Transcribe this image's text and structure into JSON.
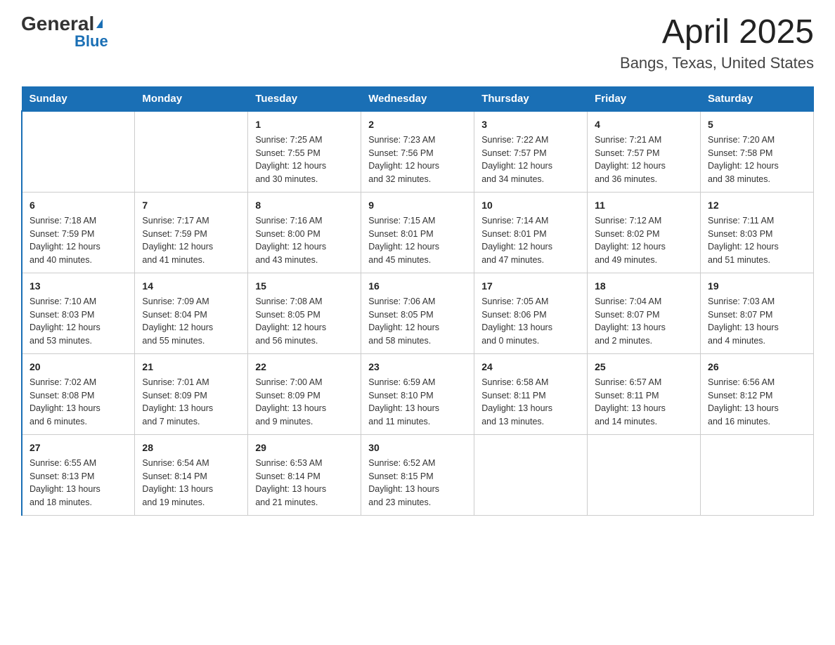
{
  "header": {
    "logo_general": "General",
    "logo_blue": "Blue",
    "title": "April 2025",
    "subtitle": "Bangs, Texas, United States"
  },
  "days_of_week": [
    "Sunday",
    "Monday",
    "Tuesday",
    "Wednesday",
    "Thursday",
    "Friday",
    "Saturday"
  ],
  "weeks": [
    [
      {
        "day": "",
        "detail": ""
      },
      {
        "day": "",
        "detail": ""
      },
      {
        "day": "1",
        "detail": "Sunrise: 7:25 AM\nSunset: 7:55 PM\nDaylight: 12 hours\nand 30 minutes."
      },
      {
        "day": "2",
        "detail": "Sunrise: 7:23 AM\nSunset: 7:56 PM\nDaylight: 12 hours\nand 32 minutes."
      },
      {
        "day": "3",
        "detail": "Sunrise: 7:22 AM\nSunset: 7:57 PM\nDaylight: 12 hours\nand 34 minutes."
      },
      {
        "day": "4",
        "detail": "Sunrise: 7:21 AM\nSunset: 7:57 PM\nDaylight: 12 hours\nand 36 minutes."
      },
      {
        "day": "5",
        "detail": "Sunrise: 7:20 AM\nSunset: 7:58 PM\nDaylight: 12 hours\nand 38 minutes."
      }
    ],
    [
      {
        "day": "6",
        "detail": "Sunrise: 7:18 AM\nSunset: 7:59 PM\nDaylight: 12 hours\nand 40 minutes."
      },
      {
        "day": "7",
        "detail": "Sunrise: 7:17 AM\nSunset: 7:59 PM\nDaylight: 12 hours\nand 41 minutes."
      },
      {
        "day": "8",
        "detail": "Sunrise: 7:16 AM\nSunset: 8:00 PM\nDaylight: 12 hours\nand 43 minutes."
      },
      {
        "day": "9",
        "detail": "Sunrise: 7:15 AM\nSunset: 8:01 PM\nDaylight: 12 hours\nand 45 minutes."
      },
      {
        "day": "10",
        "detail": "Sunrise: 7:14 AM\nSunset: 8:01 PM\nDaylight: 12 hours\nand 47 minutes."
      },
      {
        "day": "11",
        "detail": "Sunrise: 7:12 AM\nSunset: 8:02 PM\nDaylight: 12 hours\nand 49 minutes."
      },
      {
        "day": "12",
        "detail": "Sunrise: 7:11 AM\nSunset: 8:03 PM\nDaylight: 12 hours\nand 51 minutes."
      }
    ],
    [
      {
        "day": "13",
        "detail": "Sunrise: 7:10 AM\nSunset: 8:03 PM\nDaylight: 12 hours\nand 53 minutes."
      },
      {
        "day": "14",
        "detail": "Sunrise: 7:09 AM\nSunset: 8:04 PM\nDaylight: 12 hours\nand 55 minutes."
      },
      {
        "day": "15",
        "detail": "Sunrise: 7:08 AM\nSunset: 8:05 PM\nDaylight: 12 hours\nand 56 minutes."
      },
      {
        "day": "16",
        "detail": "Sunrise: 7:06 AM\nSunset: 8:05 PM\nDaylight: 12 hours\nand 58 minutes."
      },
      {
        "day": "17",
        "detail": "Sunrise: 7:05 AM\nSunset: 8:06 PM\nDaylight: 13 hours\nand 0 minutes."
      },
      {
        "day": "18",
        "detail": "Sunrise: 7:04 AM\nSunset: 8:07 PM\nDaylight: 13 hours\nand 2 minutes."
      },
      {
        "day": "19",
        "detail": "Sunrise: 7:03 AM\nSunset: 8:07 PM\nDaylight: 13 hours\nand 4 minutes."
      }
    ],
    [
      {
        "day": "20",
        "detail": "Sunrise: 7:02 AM\nSunset: 8:08 PM\nDaylight: 13 hours\nand 6 minutes."
      },
      {
        "day": "21",
        "detail": "Sunrise: 7:01 AM\nSunset: 8:09 PM\nDaylight: 13 hours\nand 7 minutes."
      },
      {
        "day": "22",
        "detail": "Sunrise: 7:00 AM\nSunset: 8:09 PM\nDaylight: 13 hours\nand 9 minutes."
      },
      {
        "day": "23",
        "detail": "Sunrise: 6:59 AM\nSunset: 8:10 PM\nDaylight: 13 hours\nand 11 minutes."
      },
      {
        "day": "24",
        "detail": "Sunrise: 6:58 AM\nSunset: 8:11 PM\nDaylight: 13 hours\nand 13 minutes."
      },
      {
        "day": "25",
        "detail": "Sunrise: 6:57 AM\nSunset: 8:11 PM\nDaylight: 13 hours\nand 14 minutes."
      },
      {
        "day": "26",
        "detail": "Sunrise: 6:56 AM\nSunset: 8:12 PM\nDaylight: 13 hours\nand 16 minutes."
      }
    ],
    [
      {
        "day": "27",
        "detail": "Sunrise: 6:55 AM\nSunset: 8:13 PM\nDaylight: 13 hours\nand 18 minutes."
      },
      {
        "day": "28",
        "detail": "Sunrise: 6:54 AM\nSunset: 8:14 PM\nDaylight: 13 hours\nand 19 minutes."
      },
      {
        "day": "29",
        "detail": "Sunrise: 6:53 AM\nSunset: 8:14 PM\nDaylight: 13 hours\nand 21 minutes."
      },
      {
        "day": "30",
        "detail": "Sunrise: 6:52 AM\nSunset: 8:15 PM\nDaylight: 13 hours\nand 23 minutes."
      },
      {
        "day": "",
        "detail": ""
      },
      {
        "day": "",
        "detail": ""
      },
      {
        "day": "",
        "detail": ""
      }
    ]
  ]
}
